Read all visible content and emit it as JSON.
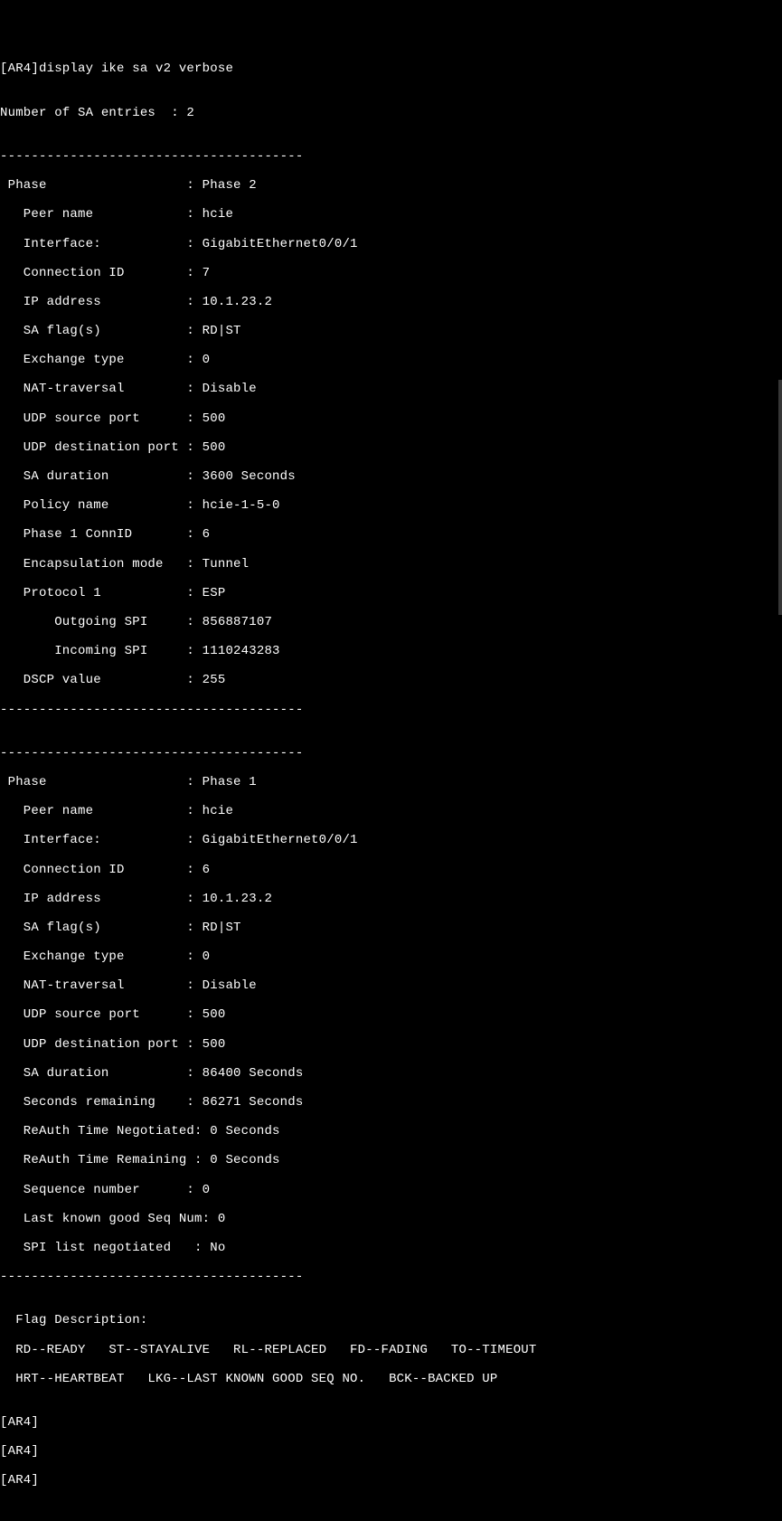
{
  "prompt_line": "[AR4]display ike sa v2 verbose",
  "blank": "",
  "sa_count_line": "Number of SA entries  : 2",
  "hr": "---------------------------------------",
  "phase2": {
    "phase": " Phase                  : Phase 2",
    "peer_name": "   Peer name            : hcie",
    "interface": "   Interface:           : GigabitEthernet0/0/1",
    "connection_id": "   Connection ID        : 7",
    "ip_address": "   IP address           : 10.1.23.2",
    "sa_flags": "   SA flag(s)           : RD|ST",
    "exchange_type": "   Exchange type        : 0",
    "nat_traversal": "   NAT-traversal        : Disable",
    "udp_src": "   UDP source port      : 500",
    "udp_dst": "   UDP destination port : 500",
    "sa_duration": "   SA duration          : 3600 Seconds",
    "policy_name": "   Policy name          : hcie-1-5-0",
    "phase1_connid": "   Phase 1 ConnID       : 6",
    "encap_mode": "   Encapsulation mode   : Tunnel",
    "protocol1": "   Protocol 1           : ESP",
    "out_spi": "       Outgoing SPI     : 856887107",
    "in_spi": "       Incoming SPI     : 1110243283",
    "dscp": "   DSCP value           : 255"
  },
  "phase1": {
    "phase": " Phase                  : Phase 1",
    "peer_name": "   Peer name            : hcie",
    "interface": "   Interface:           : GigabitEthernet0/0/1",
    "connection_id": "   Connection ID        : 6",
    "ip_address": "   IP address           : 10.1.23.2",
    "sa_flags": "   SA flag(s)           : RD|ST",
    "exchange_type": "   Exchange type        : 0",
    "nat_traversal": "   NAT-traversal        : Disable",
    "udp_src": "   UDP source port      : 500",
    "udp_dst": "   UDP destination port : 500",
    "sa_duration": "   SA duration          : 86400 Seconds",
    "seconds_remaining": "   Seconds remaining    : 86271 Seconds",
    "reauth_time_neg": "   ReAuth Time Negotiated: 0 Seconds",
    "reauth_time_rem": "   ReAuth Time Remaining : 0 Seconds",
    "seq_num": "   Sequence number      : 0",
    "last_good_seq": "   Last known good Seq Num: 0",
    "spi_list": "   SPI list negotiated   : No"
  },
  "flag_desc": {
    "header": "  Flag Description:",
    "line1": "  RD--READY   ST--STAYALIVE   RL--REPLACED   FD--FADING   TO--TIMEOUT",
    "line2": "  HRT--HEARTBEAT   LKG--LAST KNOWN GOOD SEQ NO.   BCK--BACKED UP"
  },
  "tail_prompt": "[AR4]"
}
